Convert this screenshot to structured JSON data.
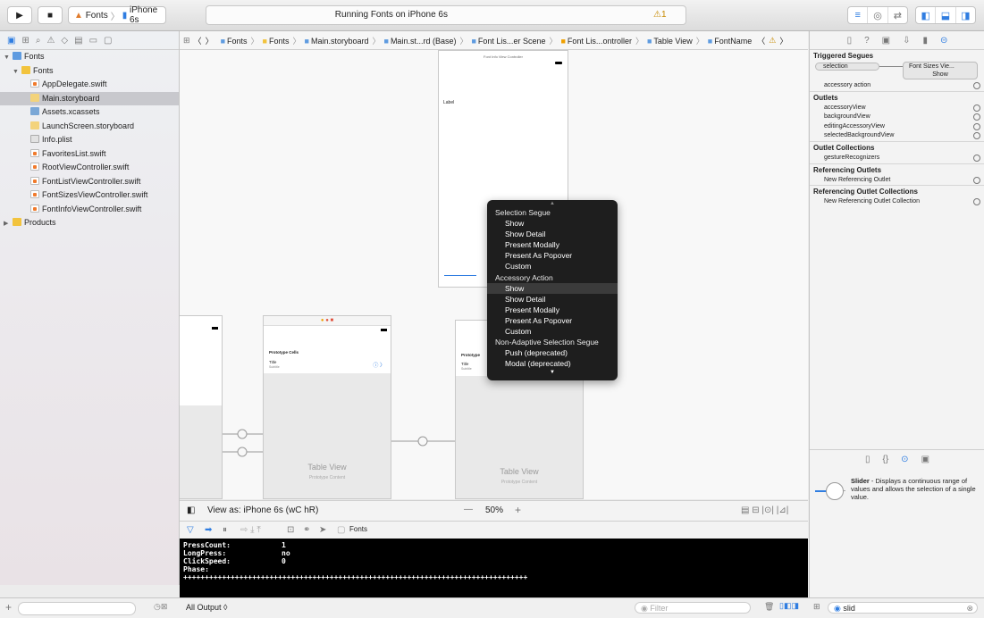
{
  "toolbar": {
    "scheme": "Fonts",
    "device": "iPhone 6s",
    "activity": "Running Fonts on iPhone 6s",
    "warning_count": "1"
  },
  "navigator": {
    "items": [
      {
        "label": "Fonts",
        "icon": "project-icon",
        "level": 0,
        "disclosure": "▼"
      },
      {
        "label": "Fonts",
        "icon": "folder-icon",
        "level": 1,
        "disclosure": "▼"
      },
      {
        "label": "AppDelegate.swift",
        "icon": "swift-file-icon",
        "level": 2
      },
      {
        "label": "Main.storyboard",
        "icon": "storyboard-icon",
        "level": 2,
        "selected": true
      },
      {
        "label": "Assets.xcassets",
        "icon": "assets-icon",
        "level": 2
      },
      {
        "label": "LaunchScreen.storyboard",
        "icon": "storyboard-icon",
        "level": 2
      },
      {
        "label": "Info.plist",
        "icon": "plist-icon",
        "level": 2
      },
      {
        "label": "FavoritesList.swift",
        "icon": "swift-file-icon",
        "level": 2
      },
      {
        "label": "RootViewController.swift",
        "icon": "swift-file-icon",
        "level": 2
      },
      {
        "label": "FontListViewController.swift",
        "icon": "swift-file-icon",
        "level": 2
      },
      {
        "label": "FontSizesViewController.swift",
        "icon": "swift-file-icon",
        "level": 2
      },
      {
        "label": "FontInfoViewController.swift",
        "icon": "swift-file-icon",
        "level": 2
      },
      {
        "label": "Products",
        "icon": "folder-icon",
        "level": 0,
        "disclosure": "▶"
      }
    ]
  },
  "jumpbar": [
    "Fonts",
    "Fonts",
    "Main.storyboard",
    "Main.st...rd (Base)",
    "Font Lis...er Scene",
    "Font Lis...ontroller",
    "Table View",
    "FontName"
  ],
  "canvas": {
    "info_title": "Font Info View Controller",
    "label": "Label",
    "prototype_cells": "Prototype Cells",
    "prototype_short": "Prototype",
    "cell_title": "Title",
    "cell_subtitle": "Subtitle",
    "table_view": "Table View",
    "prototype_content": "Prototype Content"
  },
  "menu": {
    "items": [
      {
        "label": "Selection Segue",
        "header": true
      },
      {
        "label": "Show"
      },
      {
        "label": "Show Detail"
      },
      {
        "label": "Present Modally"
      },
      {
        "label": "Present As Popover"
      },
      {
        "label": "Custom"
      },
      {
        "label": "Accessory Action",
        "header": true
      },
      {
        "label": "Show",
        "highlighted": true
      },
      {
        "label": "Show Detail"
      },
      {
        "label": "Present Modally"
      },
      {
        "label": "Present As Popover"
      },
      {
        "label": "Custom"
      },
      {
        "label": "Non-Adaptive Selection Segue",
        "header": true
      },
      {
        "label": "Push (deprecated)"
      },
      {
        "label": "Modal (deprecated)"
      }
    ]
  },
  "debugbar": {
    "view_as": "View as: iPhone 6s (wC hR)",
    "zoom": "50%",
    "target": "Fonts"
  },
  "console": {
    "lines": [
      {
        "key": "PressCount:",
        "value": "1"
      },
      {
        "key": "LongPress:",
        "value": "no"
      },
      {
        "key": "ClickSpeed:",
        "value": "0"
      },
      {
        "key": "Phase:",
        "value": ""
      }
    ],
    "rule": "++++++++++++++++++++++++++++++++++++++++++++++++++++++++++++++++++++++++++++++++"
  },
  "bottombar": {
    "output_selector": "All Output ◊",
    "filter_placeholder": "Filter",
    "library_search": "slid"
  },
  "inspector": {
    "triggered_segues": "Triggered Segues",
    "selection": "selection",
    "segue_target": "Font Sizes Vie...",
    "segue_kind": "Show",
    "accessory_action": "accessory action",
    "outlets_title": "Outlets",
    "outlets": [
      "accessoryView",
      "backgroundView",
      "editingAccessoryView",
      "selectedBackgroundView"
    ],
    "outlet_collections_title": "Outlet Collections",
    "outlet_collections": [
      "gestureRecognizers"
    ],
    "referencing_outlets_title": "Referencing Outlets",
    "referencing_outlets": [
      "New Referencing Outlet"
    ],
    "referencing_collections_title": "Referencing Outlet Collections",
    "referencing_collections": [
      "New Referencing Outlet Collection"
    ],
    "library_item_title": "Slider",
    "library_item_desc": " - Displays a continuous range of values and allows the selection of a single value."
  },
  "colors": {
    "accent": "#2f7de1",
    "warning": "#c78a00",
    "menu_bg": "#1e1e1e",
    "console_bg": "#000000"
  }
}
